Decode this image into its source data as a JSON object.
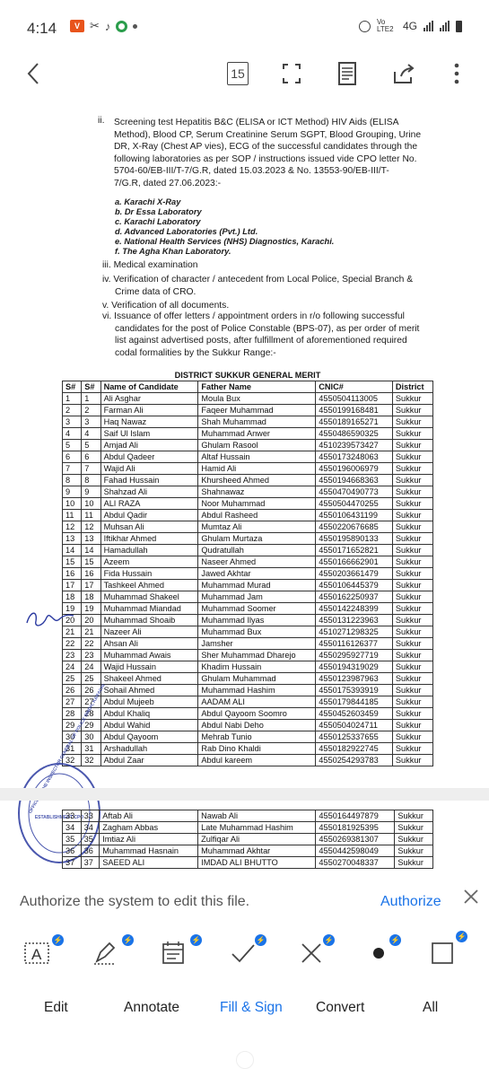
{
  "status_bar": {
    "time": "4:14",
    "network_label": "Vo LTE2",
    "network_type": "4G"
  },
  "toolbar": {
    "page_number": "15"
  },
  "document": {
    "item_ii": "ii.",
    "item_ii_text": [
      "Screening test Hepatitis B&C (ELISA or ICT Method) HIV Aids (ELISA",
      "Method), Blood CP, Serum Creatinine Serum SGPT, Blood Grouping, Urine",
      "DR, X-Ray (Chest AP vies), ECG of the successful candidates through the",
      "following laboratories as per SOP / instructions issued vide CPO letter No.",
      "5704-60/EB-III/T-7/G.R, dated 15.03.2023 & No. 13553-90/EB-III/T-",
      "7/G.R, dated 27.06.2023:-"
    ],
    "labs": [
      "a.  Karachi X-Ray",
      "b.  Dr Essa Laboratory",
      "c.  Karachi Laboratory",
      "d.  Advanced Laboratories (Pvt.) Ltd.",
      "e.  National Health Services (NHS) Diagnostics, Karachi.",
      "f.   The Agha Khan Laboratory."
    ],
    "item_iii": "iii.  Medical examination",
    "item_iv": [
      "iv.  Verification of character / antecedent from Local Police, Special Branch &",
      "Crime data of CRO."
    ],
    "item_v": "v.  Verification of all documents.",
    "item_vi": [
      "vi.  Issuance of offer letters / appointment orders in r/o following successful",
      "candidates for the post of Police Constable (BPS-07), as per order of merit",
      "list against advertised posts, after fulfillment of aforementioned required",
      "codal formalities by the Sukkur Range:-"
    ],
    "table_title": "DISTRICT SUKKUR GENERAL MERIT",
    "columns": [
      "S#",
      "S#",
      "Name of Candidate",
      "Father Name",
      "CNIC#",
      "District"
    ],
    "rows": [
      [
        "1",
        "1",
        "Ali Asghar",
        "Moula Bux",
        "4550504113005",
        "Sukkur"
      ],
      [
        "2",
        "2",
        "Farman Ali",
        "Faqeer Muhammad",
        "4550199168481",
        "Sukkur"
      ],
      [
        "3",
        "3",
        "Haq Nawaz",
        "Shah Muhammad",
        "4550189165271",
        "Sukkur"
      ],
      [
        "4",
        "4",
        "Saif Ul Islam",
        "Muhammad Anwer",
        "4550486590325",
        "Sukkur"
      ],
      [
        "5",
        "5",
        "Amjad Ali",
        "Ghulam Rasool",
        "4510239573427",
        "Sukkur"
      ],
      [
        "6",
        "6",
        "Abdul Qadeer",
        "Altaf Hussain",
        "4550173248063",
        "Sukkur"
      ],
      [
        "7",
        "7",
        "Wajid Ali",
        "Hamid Ali",
        "4550196006979",
        "Sukkur"
      ],
      [
        "8",
        "8",
        "Fahad Hussain",
        "Khursheed Ahmed",
        "4550194668363",
        "Sukkur"
      ],
      [
        "9",
        "9",
        "Shahzad Ali",
        "Shahnawaz",
        "4550470490773",
        "Sukkur"
      ],
      [
        "10",
        "10",
        "ALI RAZA",
        "Noor Muhammad",
        "4550504470255",
        "Sukkur"
      ],
      [
        "11",
        "11",
        "Abdul Qadir",
        "Abdul Rasheed",
        "4550106431199",
        "Sukkur"
      ],
      [
        "12",
        "12",
        "Muhsan Ali",
        "Mumtaz Ali",
        "4550220676685",
        "Sukkur"
      ],
      [
        "13",
        "13",
        "Iftikhar Ahmed",
        "Ghulam Murtaza",
        "4550195890133",
        "Sukkur"
      ],
      [
        "14",
        "14",
        "Hamadullah",
        "Qudratullah",
        "4550171652821",
        "Sukkur"
      ],
      [
        "15",
        "15",
        "Azeem",
        "Naseer Ahmed",
        "4550166662901",
        "Sukkur"
      ],
      [
        "16",
        "16",
        "Fida Hussain",
        "Jawed Akhtar",
        "4550203661479",
        "Sukkur"
      ],
      [
        "17",
        "17",
        "Tashkeel Ahmed",
        "Muhammad Murad",
        "4550106445379",
        "Sukkur"
      ],
      [
        "18",
        "18",
        "Muhammad Shakeel",
        "Muhammad Jam",
        "4550162250937",
        "Sukkur"
      ],
      [
        "19",
        "19",
        "Muhammad Miandad",
        "Muhammad Soomer",
        "4550142248399",
        "Sukkur"
      ],
      [
        "20",
        "20",
        "Muhammad Shoaib",
        "Muhammad Ilyas",
        "4550131223963",
        "Sukkur"
      ],
      [
        "21",
        "21",
        "Nazeer Ali",
        "Muhammad Bux",
        "4510271298325",
        "Sukkur"
      ],
      [
        "22",
        "22",
        "Ahsan Ali",
        "Jamsher",
        "4550116126377",
        "Sukkur"
      ],
      [
        "23",
        "23",
        "Muhammad Awais",
        "Sher Muhammad Dharejo",
        "4550295927719",
        "Sukkur"
      ],
      [
        "24",
        "24",
        "Wajid Hussain",
        "Khadim Hussain",
        "4550194319029",
        "Sukkur"
      ],
      [
        "25",
        "25",
        "Shakeel Ahmed",
        "Ghulam Muhammad",
        "4550123987963",
        "Sukkur"
      ],
      [
        "26",
        "26",
        "Sohail Ahmed",
        "Muhammad Hashim",
        "4550175393919",
        "Sukkur"
      ],
      [
        "27",
        "27",
        "Abdul Mujeeb",
        "AADAM ALI",
        "4550179844185",
        "Sukkur"
      ],
      [
        "28",
        "28",
        "Abdul Khaliq",
        "Abdul Qayoom Soomro",
        "4550452603459",
        "Sukkur"
      ],
      [
        "29",
        "29",
        "Abdul Wahid",
        "Abdul Nabi Deho",
        "4550504024711",
        "Sukkur"
      ],
      [
        "30",
        "30",
        "Abdul Qayoom",
        "Mehrab Tunio",
        "4550125337655",
        "Sukkur"
      ],
      [
        "31",
        "31",
        "Arshadullah",
        "Rab Dino Khaldi",
        "4550182922745",
        "Sukkur"
      ],
      [
        "32",
        "32",
        "Abdul Zaar",
        "Abdul kareem",
        "4550254293783",
        "Sukkur"
      ]
    ],
    "rows_next_page": [
      [
        "33",
        "33",
        "Aftab Ali",
        "Nawab Ali",
        "4550164497879",
        "Sukkur"
      ],
      [
        "34",
        "34",
        "Zagham Abbas",
        "Late Muhammad Hashim",
        "4550181925395",
        "Sukkur"
      ],
      [
        "35",
        "35",
        "Imtiaz Ali",
        "Zulfiqar Ali",
        "4550269381307",
        "Sukkur"
      ],
      [
        "36",
        "36",
        "Muhammad Hasnain",
        "Muhammad Akhtar",
        "4550442598049",
        "Sukkur"
      ],
      [
        "37",
        "37",
        "SAEED ALI",
        "IMDAD ALI BHUTTO",
        "4550270048337",
        "Sukkur"
      ]
    ],
    "stamp_text": "OFFICE OF THE INSPECTOR GENERAL OF POLICE SINDH, KARACHI",
    "stamp_sub": "ESTABLISHMENT CPO"
  },
  "authorize_bar": {
    "message": "Authorize the system to edit this file.",
    "action": "Authorize"
  },
  "bottom_tools": [
    {
      "label": "Edit",
      "icon": "text-box-icon"
    },
    {
      "label": "Annotate",
      "icon": "pen-icon"
    },
    {
      "label": "Fill & Sign",
      "icon": "calendar-icon"
    },
    {
      "label": "Convert",
      "icon": "checkmark-icon"
    },
    {
      "label": "All",
      "icon": "cross-icon"
    }
  ],
  "colors": {
    "accent": "#1a73e8",
    "stamp": "#2b3aa0"
  }
}
